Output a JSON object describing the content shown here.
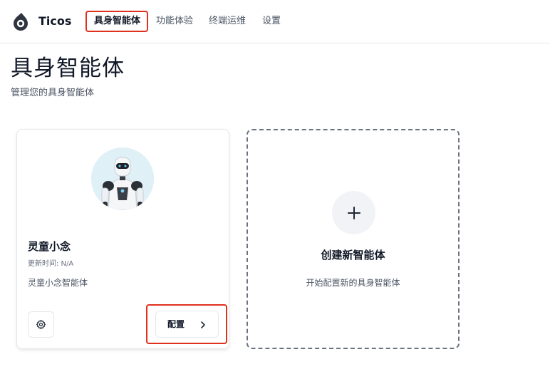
{
  "app": {
    "name": "Ticos",
    "logo_icon": "flame-drop-icon"
  },
  "nav": {
    "items": [
      {
        "label": "具身智能体",
        "active": true
      },
      {
        "label": "功能体验",
        "active": false
      },
      {
        "label": "终端运维",
        "active": false
      },
      {
        "label": "设置",
        "active": false
      }
    ]
  },
  "header": {
    "title": "具身智能体",
    "subtitle": "管理您的具身智能体"
  },
  "agents": [
    {
      "name": "灵童小念",
      "updated": "更新时间: N/A",
      "description": "灵童小念智能体",
      "avatar": "robot-avatar",
      "settings_icon": "gear-icon",
      "config_label": "配置",
      "config_icon": "chevron-right-icon"
    }
  ],
  "create_card": {
    "icon": "plus-icon",
    "title": "创建新智能体",
    "description": "开始配置新的具身智能体"
  },
  "colors": {
    "highlight": "#e0301e",
    "text_primary": "#111827",
    "text_secondary": "#4b5563",
    "border": "#e5e7eb"
  }
}
